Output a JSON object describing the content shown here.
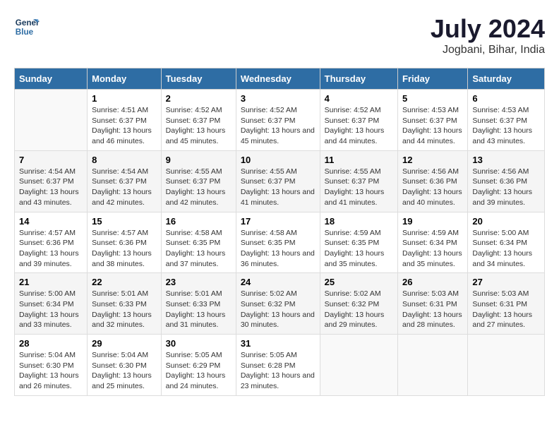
{
  "logo": {
    "line1": "General",
    "line2": "Blue"
  },
  "title": "July 2024",
  "subtitle": "Jogbani, Bihar, India",
  "days_header": [
    "Sunday",
    "Monday",
    "Tuesday",
    "Wednesday",
    "Thursday",
    "Friday",
    "Saturday"
  ],
  "weeks": [
    [
      {
        "day": "",
        "sunrise": "",
        "sunset": "",
        "daylight": ""
      },
      {
        "day": "1",
        "sunrise": "Sunrise: 4:51 AM",
        "sunset": "Sunset: 6:37 PM",
        "daylight": "Daylight: 13 hours and 46 minutes."
      },
      {
        "day": "2",
        "sunrise": "Sunrise: 4:52 AM",
        "sunset": "Sunset: 6:37 PM",
        "daylight": "Daylight: 13 hours and 45 minutes."
      },
      {
        "day": "3",
        "sunrise": "Sunrise: 4:52 AM",
        "sunset": "Sunset: 6:37 PM",
        "daylight": "Daylight: 13 hours and 45 minutes."
      },
      {
        "day": "4",
        "sunrise": "Sunrise: 4:52 AM",
        "sunset": "Sunset: 6:37 PM",
        "daylight": "Daylight: 13 hours and 44 minutes."
      },
      {
        "day": "5",
        "sunrise": "Sunrise: 4:53 AM",
        "sunset": "Sunset: 6:37 PM",
        "daylight": "Daylight: 13 hours and 44 minutes."
      },
      {
        "day": "6",
        "sunrise": "Sunrise: 4:53 AM",
        "sunset": "Sunset: 6:37 PM",
        "daylight": "Daylight: 13 hours and 43 minutes."
      }
    ],
    [
      {
        "day": "7",
        "sunrise": "Sunrise: 4:54 AM",
        "sunset": "Sunset: 6:37 PM",
        "daylight": "Daylight: 13 hours and 43 minutes."
      },
      {
        "day": "8",
        "sunrise": "Sunrise: 4:54 AM",
        "sunset": "Sunset: 6:37 PM",
        "daylight": "Daylight: 13 hours and 42 minutes."
      },
      {
        "day": "9",
        "sunrise": "Sunrise: 4:55 AM",
        "sunset": "Sunset: 6:37 PM",
        "daylight": "Daylight: 13 hours and 42 minutes."
      },
      {
        "day": "10",
        "sunrise": "Sunrise: 4:55 AM",
        "sunset": "Sunset: 6:37 PM",
        "daylight": "Daylight: 13 hours and 41 minutes."
      },
      {
        "day": "11",
        "sunrise": "Sunrise: 4:55 AM",
        "sunset": "Sunset: 6:37 PM",
        "daylight": "Daylight: 13 hours and 41 minutes."
      },
      {
        "day": "12",
        "sunrise": "Sunrise: 4:56 AM",
        "sunset": "Sunset: 6:36 PM",
        "daylight": "Daylight: 13 hours and 40 minutes."
      },
      {
        "day": "13",
        "sunrise": "Sunrise: 4:56 AM",
        "sunset": "Sunset: 6:36 PM",
        "daylight": "Daylight: 13 hours and 39 minutes."
      }
    ],
    [
      {
        "day": "14",
        "sunrise": "Sunrise: 4:57 AM",
        "sunset": "Sunset: 6:36 PM",
        "daylight": "Daylight: 13 hours and 39 minutes."
      },
      {
        "day": "15",
        "sunrise": "Sunrise: 4:57 AM",
        "sunset": "Sunset: 6:36 PM",
        "daylight": "Daylight: 13 hours and 38 minutes."
      },
      {
        "day": "16",
        "sunrise": "Sunrise: 4:58 AM",
        "sunset": "Sunset: 6:35 PM",
        "daylight": "Daylight: 13 hours and 37 minutes."
      },
      {
        "day": "17",
        "sunrise": "Sunrise: 4:58 AM",
        "sunset": "Sunset: 6:35 PM",
        "daylight": "Daylight: 13 hours and 36 minutes."
      },
      {
        "day": "18",
        "sunrise": "Sunrise: 4:59 AM",
        "sunset": "Sunset: 6:35 PM",
        "daylight": "Daylight: 13 hours and 35 minutes."
      },
      {
        "day": "19",
        "sunrise": "Sunrise: 4:59 AM",
        "sunset": "Sunset: 6:34 PM",
        "daylight": "Daylight: 13 hours and 35 minutes."
      },
      {
        "day": "20",
        "sunrise": "Sunrise: 5:00 AM",
        "sunset": "Sunset: 6:34 PM",
        "daylight": "Daylight: 13 hours and 34 minutes."
      }
    ],
    [
      {
        "day": "21",
        "sunrise": "Sunrise: 5:00 AM",
        "sunset": "Sunset: 6:34 PM",
        "daylight": "Daylight: 13 hours and 33 minutes."
      },
      {
        "day": "22",
        "sunrise": "Sunrise: 5:01 AM",
        "sunset": "Sunset: 6:33 PM",
        "daylight": "Daylight: 13 hours and 32 minutes."
      },
      {
        "day": "23",
        "sunrise": "Sunrise: 5:01 AM",
        "sunset": "Sunset: 6:33 PM",
        "daylight": "Daylight: 13 hours and 31 minutes."
      },
      {
        "day": "24",
        "sunrise": "Sunrise: 5:02 AM",
        "sunset": "Sunset: 6:32 PM",
        "daylight": "Daylight: 13 hours and 30 minutes."
      },
      {
        "day": "25",
        "sunrise": "Sunrise: 5:02 AM",
        "sunset": "Sunset: 6:32 PM",
        "daylight": "Daylight: 13 hours and 29 minutes."
      },
      {
        "day": "26",
        "sunrise": "Sunrise: 5:03 AM",
        "sunset": "Sunset: 6:31 PM",
        "daylight": "Daylight: 13 hours and 28 minutes."
      },
      {
        "day": "27",
        "sunrise": "Sunrise: 5:03 AM",
        "sunset": "Sunset: 6:31 PM",
        "daylight": "Daylight: 13 hours and 27 minutes."
      }
    ],
    [
      {
        "day": "28",
        "sunrise": "Sunrise: 5:04 AM",
        "sunset": "Sunset: 6:30 PM",
        "daylight": "Daylight: 13 hours and 26 minutes."
      },
      {
        "day": "29",
        "sunrise": "Sunrise: 5:04 AM",
        "sunset": "Sunset: 6:30 PM",
        "daylight": "Daylight: 13 hours and 25 minutes."
      },
      {
        "day": "30",
        "sunrise": "Sunrise: 5:05 AM",
        "sunset": "Sunset: 6:29 PM",
        "daylight": "Daylight: 13 hours and 24 minutes."
      },
      {
        "day": "31",
        "sunrise": "Sunrise: 5:05 AM",
        "sunset": "Sunset: 6:28 PM",
        "daylight": "Daylight: 13 hours and 23 minutes."
      },
      {
        "day": "",
        "sunrise": "",
        "sunset": "",
        "daylight": ""
      },
      {
        "day": "",
        "sunrise": "",
        "sunset": "",
        "daylight": ""
      },
      {
        "day": "",
        "sunrise": "",
        "sunset": "",
        "daylight": ""
      }
    ]
  ]
}
